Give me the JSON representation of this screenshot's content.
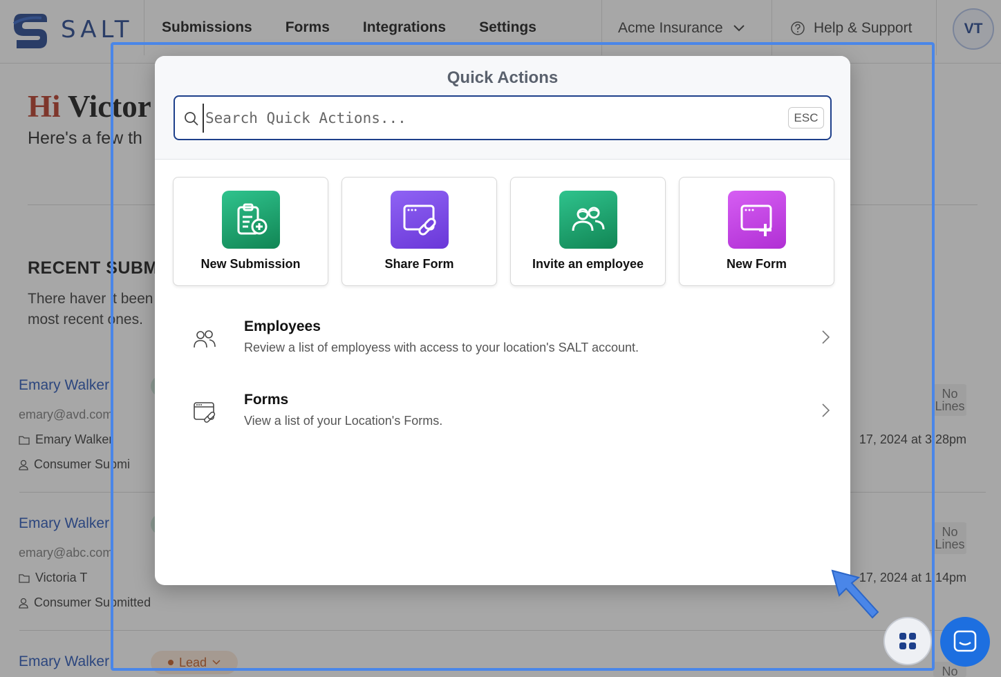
{
  "brand": {
    "name": "SALT"
  },
  "nav": {
    "items": [
      "Submissions",
      "Forms",
      "Integrations",
      "Settings"
    ]
  },
  "org": {
    "name": "Acme Insurance"
  },
  "help": {
    "label": "Help & Support"
  },
  "user": {
    "initials": "VT"
  },
  "greeting": {
    "hi": "Hi",
    "name": "Victor",
    "subtitle": "Here's a few th"
  },
  "recent": {
    "title": "RECENT SUBM",
    "subtitle": "There haver 't been most recent ones."
  },
  "submissions": [
    {
      "name": "Emary Walker",
      "email": "emary@avd.com",
      "folder": "Emary Walker",
      "source": "Consumer Submi",
      "date": "17, 2024 at 3:28pm",
      "lines": "No Lines"
    },
    {
      "name": "Emary Walker",
      "email": "emary@abc.com",
      "folder": "Victoria T",
      "source": "Consumer Submitted",
      "date": "17, 2024 at 1:14pm",
      "lines": "No Lines"
    },
    {
      "name": "Emary Walker",
      "status": "Lead",
      "lines": "No"
    }
  ],
  "modal": {
    "title": "Quick Actions",
    "search_placeholder": "Search Quick Actions...",
    "esc_label": "ESC",
    "cards": [
      {
        "label": "New Submission",
        "icon": "clipboard-plus-icon",
        "color": "#1fa06c"
      },
      {
        "label": "Share Form",
        "icon": "form-link-icon",
        "color": "#7b4ae6"
      },
      {
        "label": "Invite an employee",
        "icon": "users-icon",
        "color": "#1fa06c"
      },
      {
        "label": "New Form",
        "icon": "form-plus-icon",
        "color": "#c244e3"
      }
    ],
    "list": [
      {
        "title": "Employees",
        "description": "Review a list of employess with access to your location's SALT account."
      },
      {
        "title": "Forms",
        "description": "View a list of your Location's Forms."
      }
    ]
  },
  "colors": {
    "brand": "#1d3f8a",
    "accent": "#4a86e8",
    "greeting_hi": "#b5321e",
    "link": "#1f4fb5"
  }
}
